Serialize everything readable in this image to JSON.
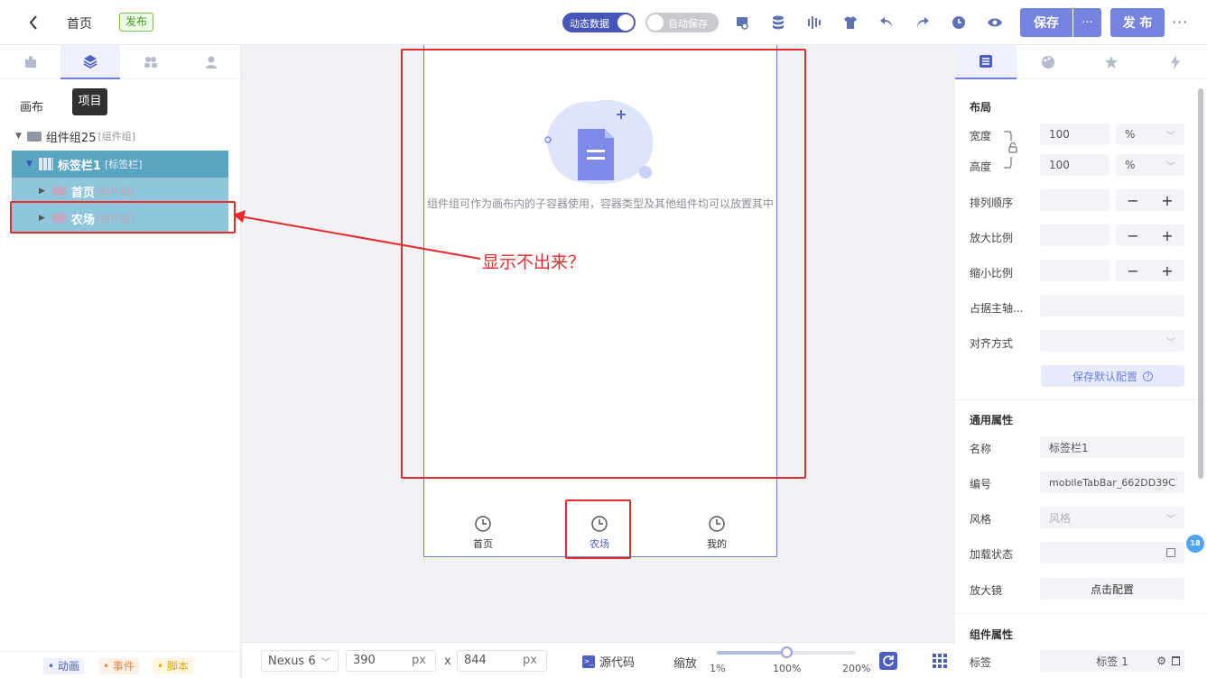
{
  "header": {
    "back_label": "",
    "page_title": "首页",
    "publish_badge": "发布",
    "dynamic_data_label": "动态数据",
    "auto_save_label": "自动保存",
    "save_label": "保存",
    "more_label": "···",
    "publish_label": "发 布",
    "overflow_label": "···"
  },
  "left_panel": {
    "tooltip": "项目",
    "canvas_label": "画布",
    "tree": {
      "group": {
        "name": "组件组25",
        "type": "[组件组]"
      },
      "tabbar": {
        "name": "标签栏1",
        "type": "[标签栏]"
      },
      "children": [
        {
          "name": "首页",
          "type": "[组件组]"
        },
        {
          "name": "农场",
          "type": "[组件组]"
        }
      ]
    },
    "footer_tags": [
      "动画",
      "事件",
      "脚本"
    ]
  },
  "canvas": {
    "empty_text": "组件组可作为画布内的子容器使用，容器类型及其他组件均可以放置其中",
    "annotation": "显示不出来？",
    "tabs": [
      {
        "label": "首页",
        "active": false
      },
      {
        "label": "农场",
        "active": true
      },
      {
        "label": "我的",
        "active": false
      }
    ]
  },
  "bottom": {
    "device": "Nexus 6",
    "width": "390",
    "height": "844",
    "unit": "px",
    "x_sep": "x",
    "source_label": "源代码",
    "zoom_label": "缩放",
    "zoom_min": "1%",
    "zoom_mid": "100%",
    "zoom_max": "200%",
    "zoom_value": 100
  },
  "right_panel": {
    "layout_title": "布局",
    "width_label": "宽度",
    "width_value": "100",
    "width_unit": "%",
    "height_label": "高度",
    "height_value": "100",
    "height_unit": "%",
    "order_label": "排列顺序",
    "grow_label": "放大比例",
    "shrink_label": "缩小比例",
    "basis_label": "占据主轴...",
    "align_label": "对齐方式",
    "save_default": "保存默认配置",
    "common_title": "通用属性",
    "name_label": "名称",
    "name_value": "标签栏1",
    "id_label": "编号",
    "id_value": "mobileTabBar_662DD39C",
    "style_label": "风格",
    "style_placeholder": "风格",
    "loading_label": "加载状态",
    "magnifier_label": "放大镜",
    "magnifier_btn": "点击配置",
    "comp_title": "组件属性",
    "tag_label": "标签",
    "tag_value": "标签 1",
    "badge": "18"
  },
  "colors": {
    "primary": "#6d7fe0",
    "tree_parent": "#5aa5c2",
    "tree_child": "#8ec7dc",
    "red": "#e52b2b",
    "publish_green": "#52b32d"
  }
}
